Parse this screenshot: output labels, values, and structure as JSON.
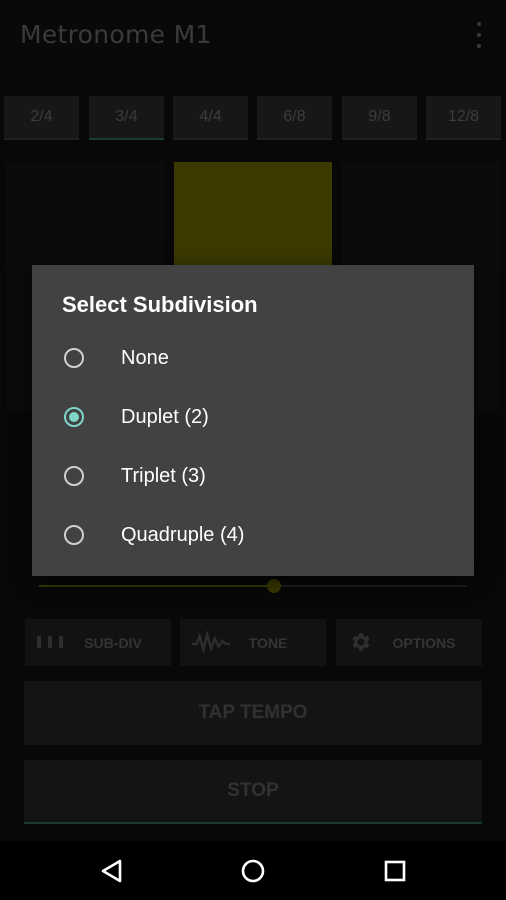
{
  "app": {
    "title": "Metronome M1"
  },
  "time_signatures": [
    {
      "label": "2/4",
      "active": false
    },
    {
      "label": "3/4",
      "active": true
    },
    {
      "label": "4/4",
      "active": false
    },
    {
      "label": "6/8",
      "active": false
    },
    {
      "label": "9/8",
      "active": false
    },
    {
      "label": "12/8",
      "active": false
    }
  ],
  "beats": [
    {
      "active": false
    },
    {
      "active": true
    },
    {
      "active": false
    }
  ],
  "tempo_slider": {
    "value_fraction": 0.55,
    "accent_color": "#6b6b00"
  },
  "toolbar": {
    "subdiv_label": "SUB-DIV",
    "tone_label": "TONE",
    "options_label": "OPTIONS"
  },
  "buttons": {
    "tap_tempo_label": "TAP TEMPO",
    "stop_label": "STOP"
  },
  "dialog": {
    "title": "Select Subdivision",
    "options": [
      {
        "label": "None",
        "checked": false
      },
      {
        "label": "Duplet (2)",
        "checked": true
      },
      {
        "label": "Triplet (3)",
        "checked": false
      },
      {
        "label": "Quadruple (4)",
        "checked": false
      }
    ]
  },
  "colors": {
    "beat_active": "#6e6b00",
    "radio_accent": "#7fd6c8",
    "dialog_bg": "#424242"
  },
  "navbar": {
    "icons": [
      "back-icon",
      "home-icon",
      "recents-icon"
    ]
  }
}
